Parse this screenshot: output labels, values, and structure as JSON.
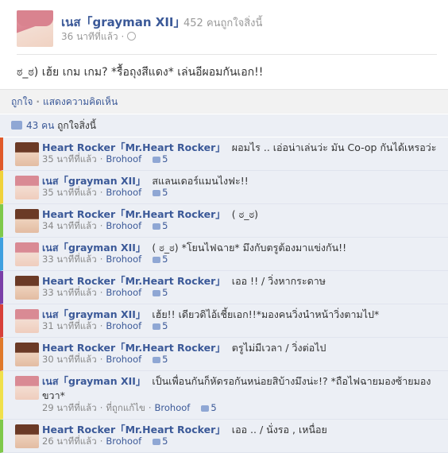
{
  "post": {
    "author": "เนส「grayman XII」",
    "likes_summary": "452 คนถูกใจสิ่งนี้",
    "time": "36 นาทีที่แล้ว",
    "message": "ಠ_ಠ) เฮ้ย เกม เกม? *รื้อถุงสีแดง* เล่นอีผอมกันเอก!!"
  },
  "actions": {
    "like": "ถูกใจ",
    "separator": "·",
    "comment": "แสดงความคิดเห็น"
  },
  "likebar": {
    "count": "43 คน",
    "text": "ถูกใจสิ่งนี้"
  },
  "comments": [
    {
      "author": "Heart Rocker「Mr.Heart Rocker」",
      "text": "ผอมไร .. เอ่อน่าเล่นว่ะ มัน Co-op กันได้เหรอว่ะ",
      "time": "35 นาทีที่แล้ว",
      "via": "Brohoof",
      "likes": "5",
      "bar": "#e05a2b",
      "avatar": "brown"
    },
    {
      "author": "เนส「grayman XII」",
      "text": "สแลนเดอร์แมนไงฟะ!!",
      "time": "35 นาทีที่แล้ว",
      "via": "Brohoof",
      "likes": "5",
      "bar": "#f0d23a",
      "avatar": "pink"
    },
    {
      "author": "Heart Rocker「Mr.Heart Rocker」",
      "text": "( ಠ_ಠ)",
      "time": "34 นาทีที่แล้ว",
      "via": "Brohoof",
      "likes": "5",
      "bar": "#7fc94a",
      "avatar": "brown"
    },
    {
      "author": "เนส「grayman XII」",
      "text": "( ಠ_ಠ) *โยนไฟฉาย* มึงกับตรูต้องมาแข่งกัน!!",
      "time": "33 นาทีที่แล้ว",
      "via": "Brohoof",
      "likes": "5",
      "bar": "#3fa0e0",
      "avatar": "pink"
    },
    {
      "author": "Heart Rocker「Mr.Heart Rocker」",
      "text": "เออ !! / วิ่งหากระดาษ",
      "time": "33 นาทีที่แล้ว",
      "via": "Brohoof",
      "likes": "5",
      "bar": "#7b3fa8",
      "avatar": "brown"
    },
    {
      "author": "เนส「grayman XII」",
      "text": "เฮ้ย!! เดียวดิไอ้เชี้ยเอก!!*มองคนวิ่งนำหน้าวิ่งตามไป*",
      "time": "31 นาทีที่แล้ว",
      "via": "Brohoof",
      "likes": "5",
      "bar": "#d8403a",
      "avatar": "pink"
    },
    {
      "author": "Heart Rocker「Mr.Heart Rocker」",
      "text": "ตรูไม่มีเวลา / วิ่งต่อไป",
      "time": "30 นาทีที่แล้ว",
      "via": "Brohoof",
      "likes": "5",
      "bar": "#e07a2b",
      "avatar": "brown"
    },
    {
      "author": "เนส「grayman XII」",
      "text": "เป็นเพื่อนกันก็หัดรอกันหน่อยสิบ้างมึงน่ะ!? *ถือไฟฉายมองซ้ายมองขวา*",
      "time": "29 นาทีที่แล้ว",
      "edited": "ที่ถูกแก้ไข",
      "via": "Brohoof",
      "likes": "5",
      "bar": "#f0e04a",
      "avatar": "pink",
      "tall": true
    },
    {
      "author": "Heart Rocker「Mr.Heart Rocker」",
      "text": "เออ .. / นั่งรอ , เหนื่อย",
      "time": "26 นาทีที่แล้ว",
      "via": "Brohoof",
      "likes": "5",
      "bar": "#7fc94a",
      "avatar": "brown"
    }
  ]
}
